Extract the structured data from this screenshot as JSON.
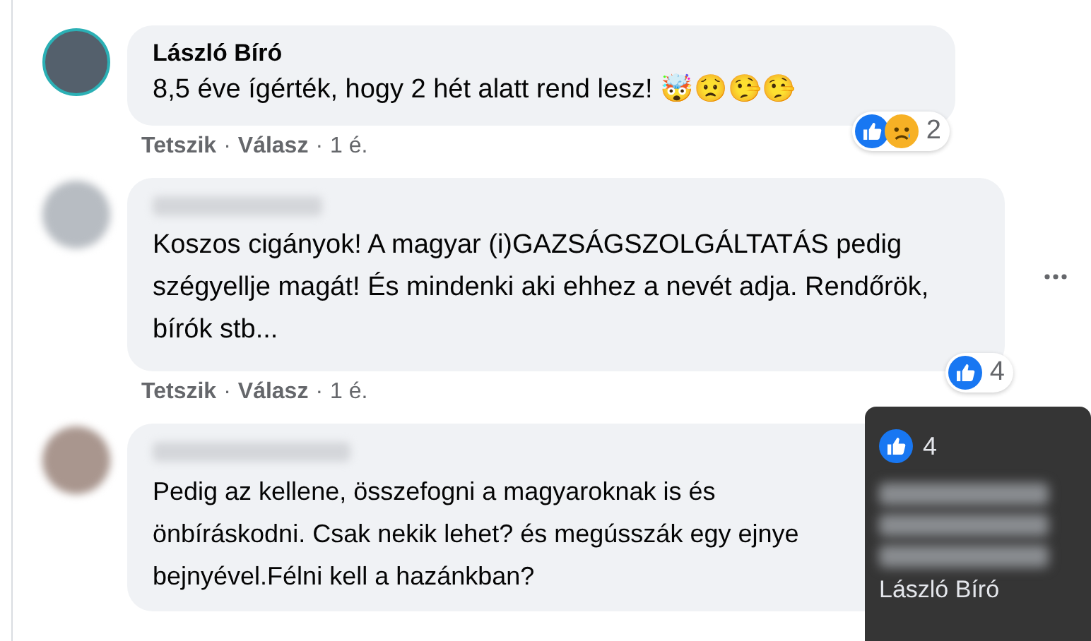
{
  "comments": [
    {
      "author": {
        "kind": "name",
        "text": "László Bíró"
      },
      "avatar": {
        "kind": "photo"
      },
      "text": "8,5 éve ígérték, hogy 2 hét alatt rend lesz! 🤯😟🤥🤥",
      "reactions": {
        "icons": [
          {
            "kind": "like"
          },
          {
            "kind": "sad"
          }
        ],
        "count": "2"
      },
      "actions": [
        {
          "label": "Tetszik"
        },
        {
          "label": "Válasz"
        }
      ],
      "separator": "·",
      "time": "1 é.",
      "more_menu": false
    },
    {
      "author": {
        "kind": "blurred"
      },
      "avatar": {
        "kind": "blurred"
      },
      "text": "Koszos cigányok! A magyar (i)GAZSÁGSZOLGÁLTATÁS pedig szégyellje magát! És mindenki aki ehhez a nevét adja. Rendőrök, bírók stb...",
      "reactions": {
        "icons": [
          {
            "kind": "like"
          }
        ],
        "count": "4"
      },
      "actions": [
        {
          "label": "Tetszik"
        },
        {
          "label": "Válasz"
        }
      ],
      "separator": "·",
      "time": "1 é.",
      "more_menu": true
    },
    {
      "author": {
        "kind": "blurred"
      },
      "avatar": {
        "kind": "blurred"
      },
      "text": "Pedig az kellene, összefogni a magyaroknak is és önbíráskodni. Csak nekik lehet? és megússzák egy ejnye bejnyével.Félni kell a hazánkban?",
      "more_menu": false
    }
  ],
  "tooltip": {
    "icon": {
      "kind": "like"
    },
    "count": "4",
    "name": "László Bíró"
  }
}
